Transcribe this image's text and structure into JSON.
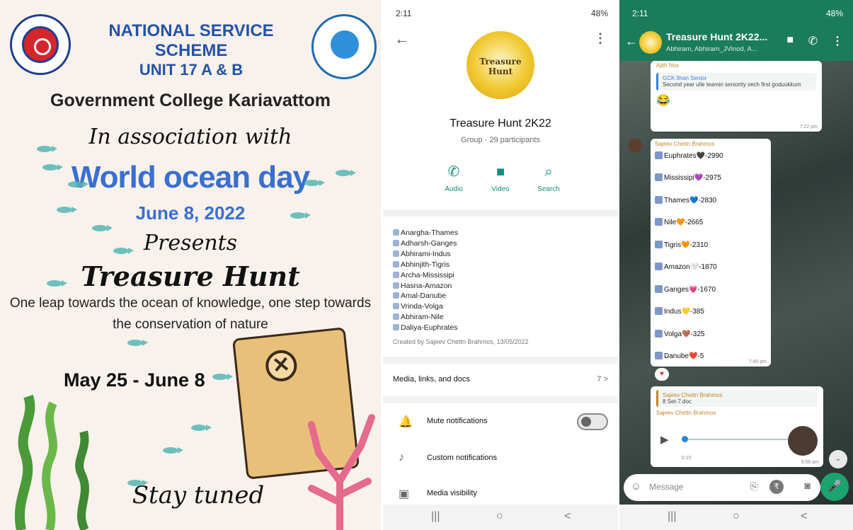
{
  "poster": {
    "org": "NATIONAL SERVICE SCHEME",
    "unit": "UNIT 17 A & B",
    "college": "Government College Kariavattom",
    "association": "In association with",
    "event": "World ocean day",
    "event_date": "June 8, 2022",
    "presents": "Presents",
    "title": "Treasure Hunt",
    "tagline": "One leap towards the ocean of knowledge, one step towards the conservation of nature",
    "date_range": "May 25 - June 8",
    "closing": "Stay tuned",
    "logo_text": "Treasure Hunt"
  },
  "info": {
    "status_time": "2:11",
    "status_right": "48%",
    "group_name": "Treasure Hunt 2K22",
    "group_meta": "Group · 29 participants",
    "actions": {
      "audio": "Audio",
      "video": "Video",
      "search": "Search"
    },
    "description": [
      "Anargha-Thames",
      "Adharsh-Ganges",
      "Abhirami-Indus",
      "Abhinjith-Tigris",
      "Archa-Mississipi",
      "Hasna-Amazon",
      "Amal-Danube",
      "Vrinda-Volga",
      "Abhiram-Nile",
      "Daliya-Euphrates"
    ],
    "created": "Created by Sajeev Chettn Brahmos, 13/05/2022",
    "media_label": "Media, links, and docs",
    "media_count": "7 >",
    "settings": {
      "mute": "Mute notifications",
      "custom": "Custom notifications",
      "visibility": "Media visibility"
    }
  },
  "chat": {
    "status_time": "2:11",
    "status_right": "48%",
    "title": "Treasure Hunt 2K22...",
    "members": "Abhiram, Abhiram_JVinod, A...",
    "msg1": {
      "sender": "Ajith Nox",
      "quote_sender": "GCK Ilhan Senior",
      "quote_text": "Second year ulle teamin seniority vech first goduukkum",
      "emoji": "😂",
      "time": "7:22 pm"
    },
    "msg2": {
      "sender": "Sajeev Chettn Brahmos",
      "time": "7:40 pm",
      "rankings": [
        "Euphrates🖤-2990",
        "Mississipi💜-2975",
        "Thames💙-2830",
        "Nile🧡-2665",
        "Tigris🧡-2310",
        "Amazon🤍-1870",
        "Ganges💗-1670",
        "Indus💛-385",
        "Volga🤎-325",
        "Danube❤️-5"
      ],
      "reaction": "♥"
    },
    "msg3": {
      "quote_sender": "Sajeev Chettn Brahmos",
      "quote_text": "8 Set-7.doc",
      "sender": "Sajeev Chettn Brahmos",
      "duration": "0:15",
      "time": "9:56 pm"
    },
    "composer_placeholder": "Message"
  },
  "nav": {
    "recent": "|||",
    "home": "○",
    "back": "<"
  }
}
